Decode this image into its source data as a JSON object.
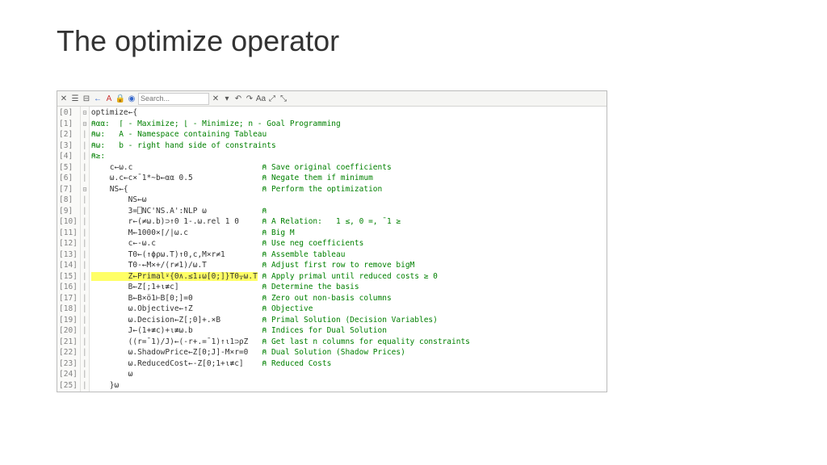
{
  "title": "The optimize operator",
  "search_placeholder": "Search...",
  "gutter": [
    "[0]",
    "[1]",
    "[2]",
    "[3]",
    "[4]",
    "[5]",
    "[6]",
    "[7]",
    "[8]",
    "[9]",
    "[10]",
    "[11]",
    "[12]",
    "[13]",
    "[14]",
    "[15]",
    "[16]",
    "[17]",
    "[18]",
    "[19]",
    "[20]",
    "[21]",
    "[22]",
    "[23]",
    "[24]",
    "[25]"
  ],
  "lines": [
    {
      "code": "optimize←{",
      "comment": ""
    },
    {
      "code": "⍝αα:  ⌈ - Maximize; ⌊ - Minimize; n - Goal Programming",
      "comment": "",
      "allcomment": true
    },
    {
      "code": "⍝ω:   A - Namespace containing Tableau",
      "comment": "",
      "allcomment": true
    },
    {
      "code": "⍝ω:   b - right hand side of constraints",
      "comment": "",
      "allcomment": true
    },
    {
      "code": "⍝≥:",
      "comment": "",
      "allcomment": true
    },
    {
      "code": "    c←ω.c",
      "comment": "⍝ Save original coefficients"
    },
    {
      "code": "    ω.c←c×¯1*~b←αα 0.5",
      "comment": "⍝ Negate them if minimum"
    },
    {
      "code": "    NS←{",
      "comment": "⍝ Perform the optimization"
    },
    {
      "code": "        NS←ω",
      "comment": ""
    },
    {
      "code": "        3=⎕NC'NS.A':NLP ω",
      "comment": "⍝"
    },
    {
      "code": "        r←(≠ω.b)⊃↑0 1-.ω.rel 1 0",
      "comment": "⍝ A Relation:   1 ≤, 0 =, ¯1 ≥"
    },
    {
      "code": "        M←1000×⌈/|ω.c",
      "comment": "⍝ Big M"
    },
    {
      "code": "        c←-ω.c",
      "comment": "⍝ Use neg coefficients"
    },
    {
      "code": "        T0←(↑ϕρω.T)↑0,c,M×r≠1",
      "comment": "⍝ Assemble tableau"
    },
    {
      "code": "        T0-←M×+/(r≠1)/ω.T",
      "comment": "⍝ Adjust first row to remove bigM"
    },
    {
      "code": "        Z←Primal⍣{0∧.≤1↓ω[0;]}T0⍪ω.T",
      "comment": "⍝ Apply primal until reduced costs ≥ 0",
      "hl": true
    },
    {
      "code": "        B←Z[;1+⍳≢c]",
      "comment": "⍝ Determine the basis"
    },
    {
      "code": "        B←B×ö1⊢B[0;]=0",
      "comment": "⍝ Zero out non-basis columns"
    },
    {
      "code": "        ω.Objective←↑Z",
      "comment": "⍝ Objective"
    },
    {
      "code": "        ω.Decision←Z[;0]+.×B",
      "comment": "⍝ Primal Solution (Decision Variables)"
    },
    {
      "code": "        J←(1+≢c)+⍳≢ω.b",
      "comment": "⍝ Indices for Dual Solution"
    },
    {
      "code": "        ((r=¯1)/J)←(-r+.=¯1)↑⍳1⊃ρZ",
      "comment": "⍝ Get last n columns for equality constraints"
    },
    {
      "code": "        ω.ShadowPrice←Z[0;J]-M×r=0",
      "comment": "⍝ Dual Solution (Shadow Prices)"
    },
    {
      "code": "        ω.ReducedCost←-Z[0;1+⍳≢c]",
      "comment": "⍝ Reduced Costs"
    },
    {
      "code": "        ω",
      "comment": ""
    },
    {
      "code": "    }ω",
      "comment": ""
    }
  ],
  "comment_col": 37
}
